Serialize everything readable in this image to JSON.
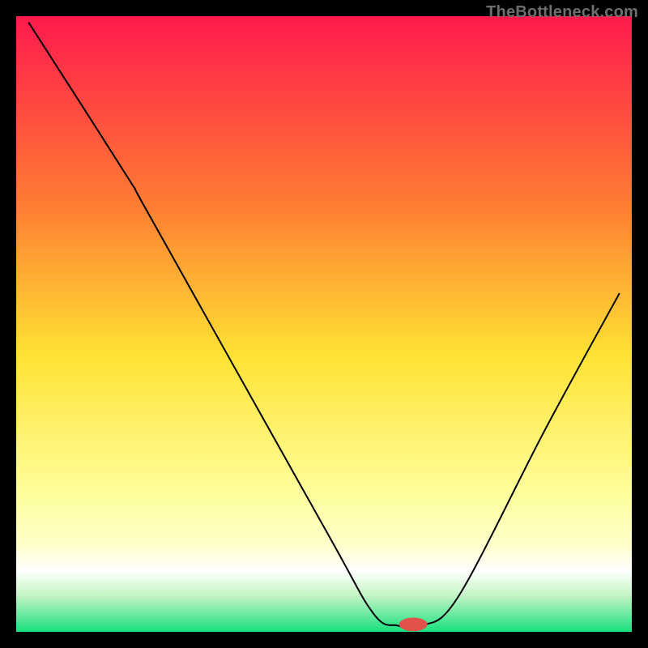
{
  "watermark": "TheBottleneck.com",
  "colors": {
    "page_bg": "#000000",
    "gradient_top": "#ff1a4d",
    "gradient_mid_upper": "#ff7a33",
    "gradient_mid": "#ffe233",
    "gradient_lower": "#ffff9e",
    "gradient_band_yellow": "#ffffcc",
    "gradient_band_white": "#ffffff",
    "gradient_bottom": "#18e07f",
    "curve": "#000000",
    "marker": "#e2514b"
  },
  "chart_data": {
    "type": "line",
    "title": "",
    "xlabel": "",
    "ylabel": "",
    "xlim": [
      0,
      100
    ],
    "ylim": [
      0,
      100
    ],
    "series": [
      {
        "name": "bottleneck-curve",
        "control_points": [
          {
            "x": 2,
            "y": 99
          },
          {
            "x": 18,
            "y": 74
          },
          {
            "x": 22,
            "y": 67
          },
          {
            "x": 50,
            "y": 17
          },
          {
            "x": 58,
            "y": 3
          },
          {
            "x": 62,
            "y": 1
          },
          {
            "x": 66,
            "y": 1
          },
          {
            "x": 72,
            "y": 6
          },
          {
            "x": 86,
            "y": 33
          },
          {
            "x": 98,
            "y": 55
          }
        ]
      }
    ],
    "marker": {
      "x": 64.5,
      "y": 1.2,
      "rx": 2.3,
      "ry": 1.1
    },
    "gradient_stops": [
      {
        "offset": 0,
        "color": "#ff1a4d"
      },
      {
        "offset": 0.3,
        "color": "#ff7a33"
      },
      {
        "offset": 0.55,
        "color": "#ffe233"
      },
      {
        "offset": 0.78,
        "color": "#ffff9e"
      },
      {
        "offset": 0.86,
        "color": "#ffffcc"
      },
      {
        "offset": 0.9,
        "color": "#ffffff"
      },
      {
        "offset": 0.94,
        "color": "#c6f5c7"
      },
      {
        "offset": 1.0,
        "color": "#18e07f"
      }
    ]
  }
}
